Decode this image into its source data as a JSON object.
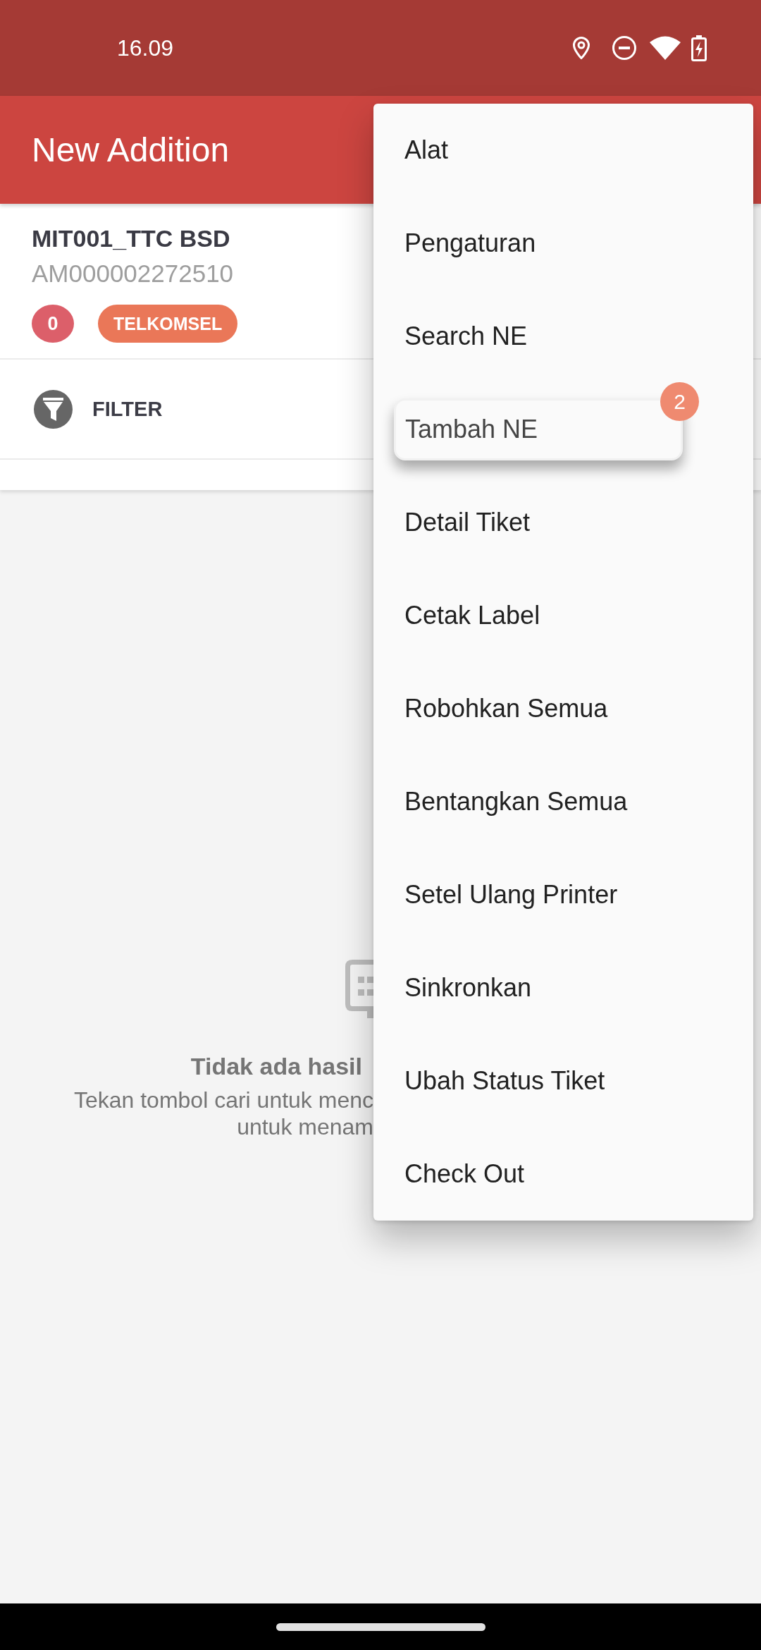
{
  "status_bar": {
    "time": "16.09"
  },
  "app_bar": {
    "title": "New Addition"
  },
  "site_card": {
    "name": "MIT001_TTC BSD",
    "code": "AM000002272510",
    "badges": [
      {
        "kind": "count",
        "text": "0"
      },
      {
        "kind": "tag",
        "text": "TELKOMSEL"
      }
    ]
  },
  "filter": {
    "label": "FILTER"
  },
  "empty_state": {
    "title": "Tidak ada hasil",
    "description_lines": [
      "Tekan tombol cari untuk menc",
      "untuk menam"
    ]
  },
  "menu": {
    "items": [
      {
        "label": "Alat",
        "highlighted": false
      },
      {
        "label": "Pengaturan",
        "highlighted": false
      },
      {
        "label": "Search NE",
        "highlighted": false
      },
      {
        "label": "Tambah NE",
        "highlighted": true,
        "step_badge": "2"
      },
      {
        "label": "Detail Tiket",
        "highlighted": false
      },
      {
        "label": "Cetak Label",
        "highlighted": false
      },
      {
        "label": "Robohkan Semua",
        "highlighted": false
      },
      {
        "label": "Bentangkan Semua",
        "highlighted": false
      },
      {
        "label": "Setel Ulang Printer",
        "highlighted": false
      },
      {
        "label": "Sinkronkan",
        "highlighted": false
      },
      {
        "label": "Ubah Status Tiket",
        "highlighted": false
      },
      {
        "label": "Check Out",
        "highlighted": false
      }
    ]
  }
}
